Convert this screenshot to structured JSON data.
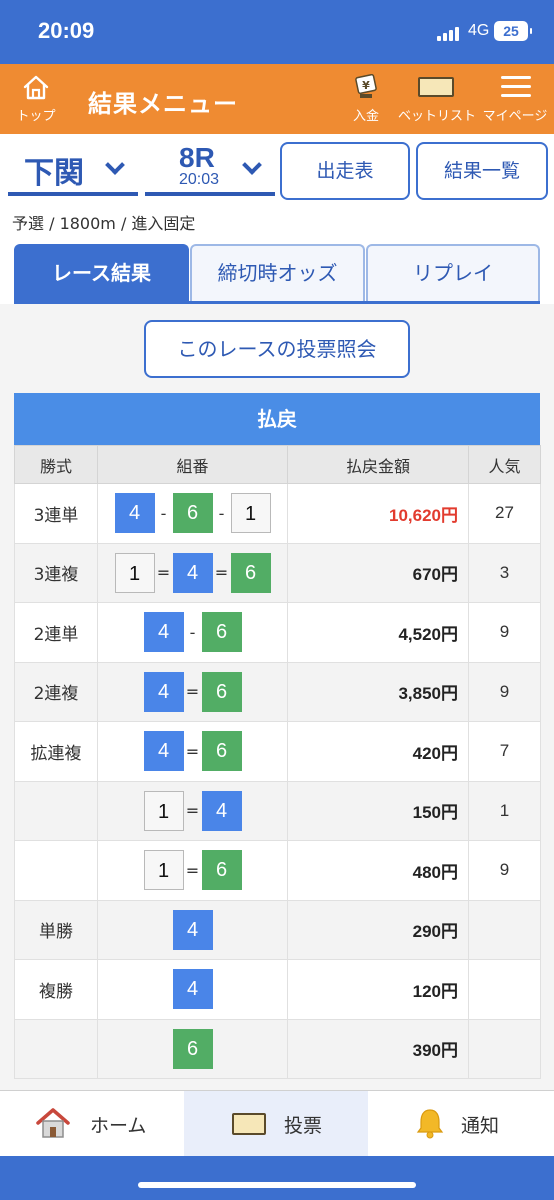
{
  "status_bar": {
    "time": "20:09",
    "network": "4G",
    "battery": "25"
  },
  "header": {
    "home_label": "トップ",
    "title": "結果メニュー",
    "deposit_label": "入金",
    "betlist_label": "ベットリスト",
    "mypage_label": "マイページ"
  },
  "selector": {
    "venue": "下関",
    "race_number": "8R",
    "race_time": "20:03",
    "entry_list_button": "出走表",
    "results_list_button": "結果一覧"
  },
  "race_info": "予選 / 1800m / 進入固定",
  "tabs": [
    "レース結果",
    "締切時オッズ",
    "リプレイ"
  ],
  "active_tab": "レース結果",
  "inquiry_button": "このレースの投票照会",
  "payout": {
    "title": "払戻",
    "headers": [
      "勝式",
      "組番",
      "払戻金額",
      "人気"
    ],
    "rows": [
      {
        "kind": "3連単",
        "combo": [
          "4",
          "-",
          "6",
          "-",
          "1"
        ],
        "amount": "10,620円",
        "popularity": "27"
      },
      {
        "kind": "3連複",
        "combo": [
          "1",
          "=",
          "4",
          "=",
          "6"
        ],
        "amount": "670円",
        "popularity": "3"
      },
      {
        "kind": "2連単",
        "combo": [
          "4",
          "-",
          "6"
        ],
        "amount": "4,520円",
        "popularity": "9"
      },
      {
        "kind": "2連複",
        "combo": [
          "4",
          "=",
          "6"
        ],
        "amount": "3,850円",
        "popularity": "9"
      },
      {
        "kind": "拡連複",
        "combo": [
          "4",
          "=",
          "6"
        ],
        "amount": "420円",
        "popularity": "7"
      },
      {
        "kind": "",
        "combo": [
          "1",
          "=",
          "4"
        ],
        "amount": "150円",
        "popularity": "1"
      },
      {
        "kind": "",
        "combo": [
          "1",
          "=",
          "6"
        ],
        "amount": "480円",
        "popularity": "9"
      },
      {
        "kind": "単勝",
        "combo": [
          "4"
        ],
        "amount": "290円",
        "popularity": ""
      },
      {
        "kind": "複勝",
        "combo": [
          "4"
        ],
        "amount": "120円",
        "popularity": ""
      },
      {
        "kind": "",
        "combo": [
          "6"
        ],
        "amount": "390円",
        "popularity": ""
      }
    ]
  },
  "bottom_nav": {
    "home": "ホーム",
    "vote": "投票",
    "notify": "通知"
  },
  "colors": {
    "primary": "#3c6fcf",
    "header_orange": "#ef8b32",
    "boat_1": "#f7f7f7",
    "boat_4": "#4a85e8",
    "boat_6": "#52ad65",
    "highlight_amount": "#e23b2e"
  }
}
